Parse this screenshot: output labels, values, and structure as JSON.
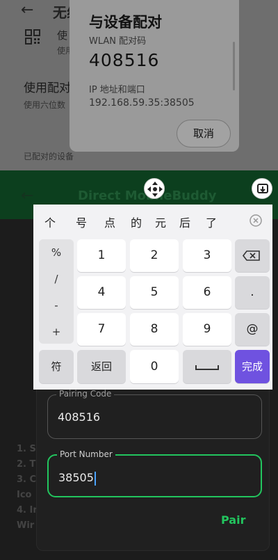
{
  "settings": {
    "back_glyph": "←",
    "title": "无线",
    "qr_title": "使",
    "qr_subtitle": "使用",
    "code_title": "使用配对",
    "code_subtitle": "使用六位数",
    "paired_label": "已配对的设备"
  },
  "dialog": {
    "title": "与设备配对",
    "wlan_label": "WLAN 配对码",
    "code": "408516",
    "ip_label": "IP 地址和端口",
    "ip_value": "192.168.59.35:38505",
    "cancel_label": "取消"
  },
  "app": {
    "back_glyph": "←",
    "title": "Direct MobileBuddy",
    "list_lines": [
      "1. St",
      "2. T",
      "3. C",
      "Ico",
      "4. In",
      "Wir"
    ],
    "pairing_label": "Pairing Code",
    "pairing_value": "408516",
    "port_label": "Port Number",
    "port_value": "38505",
    "pair_button": "Pair"
  },
  "keyboard": {
    "candidates": [
      "个",
      "号",
      "点",
      "的",
      "元",
      "后",
      "了"
    ],
    "symbols": [
      "%",
      "/",
      "-",
      "+"
    ],
    "digits": [
      "1",
      "2",
      "3",
      "4",
      "5",
      "6",
      "7",
      "8",
      "9",
      "0"
    ],
    "dot": ".",
    "at": "@",
    "symbol_key": "符",
    "back_key": "返回",
    "done_key": "完成",
    "accent_color": "#6f52e0"
  },
  "colors": {
    "accent_green": "#22c55e"
  }
}
